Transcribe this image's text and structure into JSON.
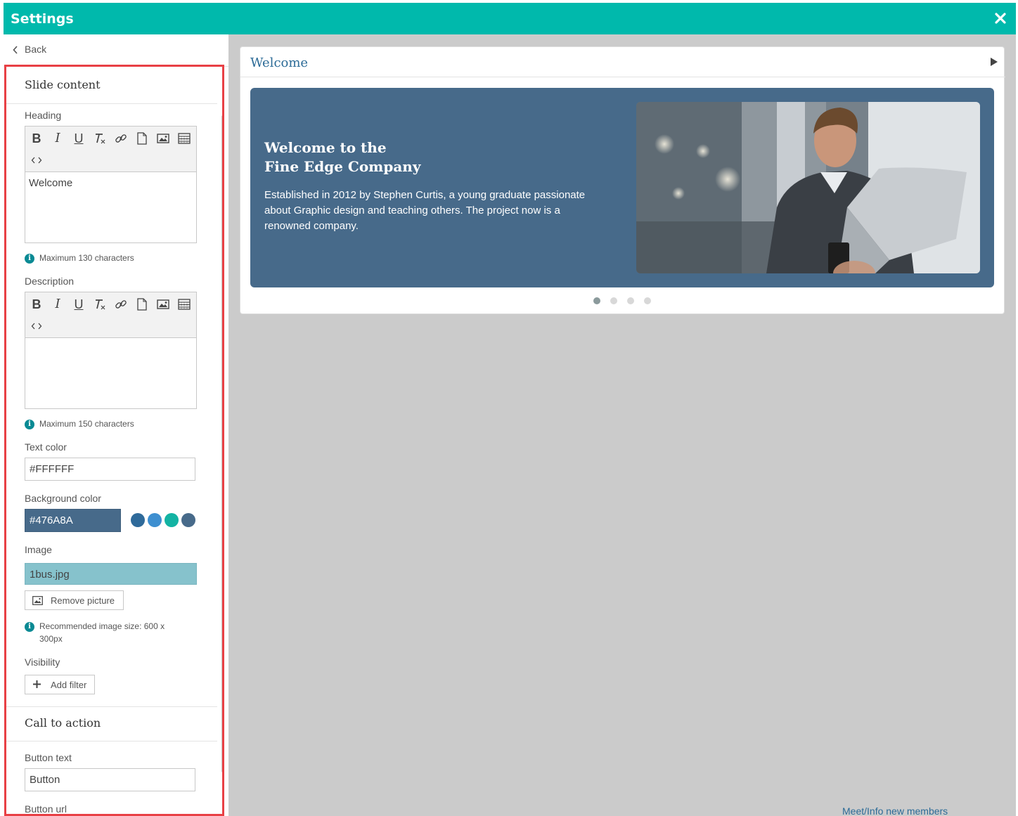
{
  "window": {
    "title": "Settings"
  },
  "panel": {
    "back_label": "Back",
    "slide_content": {
      "title": "Slide content",
      "heading": {
        "label": "Heading",
        "value": "Welcome",
        "hint": "Maximum 130 characters"
      },
      "description": {
        "label": "Description",
        "value": "",
        "hint": "Maximum 150 characters"
      },
      "text_color": {
        "label": "Text color",
        "value": "#FFFFFF"
      },
      "background_color": {
        "label": "Background color",
        "value": "#476A8A",
        "swatches": [
          "#2f6a9a",
          "#3e8fd0",
          "#13b3a3",
          "#476a8a"
        ]
      },
      "image": {
        "label": "Image",
        "value": "1bus.jpg",
        "remove_label": "Remove picture",
        "hint": "Recommended image size: 600 x 300px"
      },
      "visibility": {
        "label": "Visibility",
        "add_filter_label": "Add filter"
      }
    },
    "call_to_action": {
      "title": "Call to action",
      "button_text": {
        "label": "Button text",
        "value": "Button"
      },
      "button_url": {
        "label": "Button url"
      }
    }
  },
  "preview": {
    "title": "Welcome",
    "slide": {
      "heading_line1": "Welcome to the",
      "heading_line2": "Fine Edge Company",
      "description": "Established in 2012 by Stephen Curtis, a young graduate passionate about Graphic design and teaching others. The project now is a renowned company.",
      "background": "#476A8A",
      "text_color": "#FFFFFF"
    },
    "dots": {
      "count": 4,
      "active": 1
    }
  },
  "footer": {
    "partial_text": "Meet/Info new members"
  },
  "colors": {
    "accent": "#00b9ac",
    "highlight": "#e84045"
  }
}
